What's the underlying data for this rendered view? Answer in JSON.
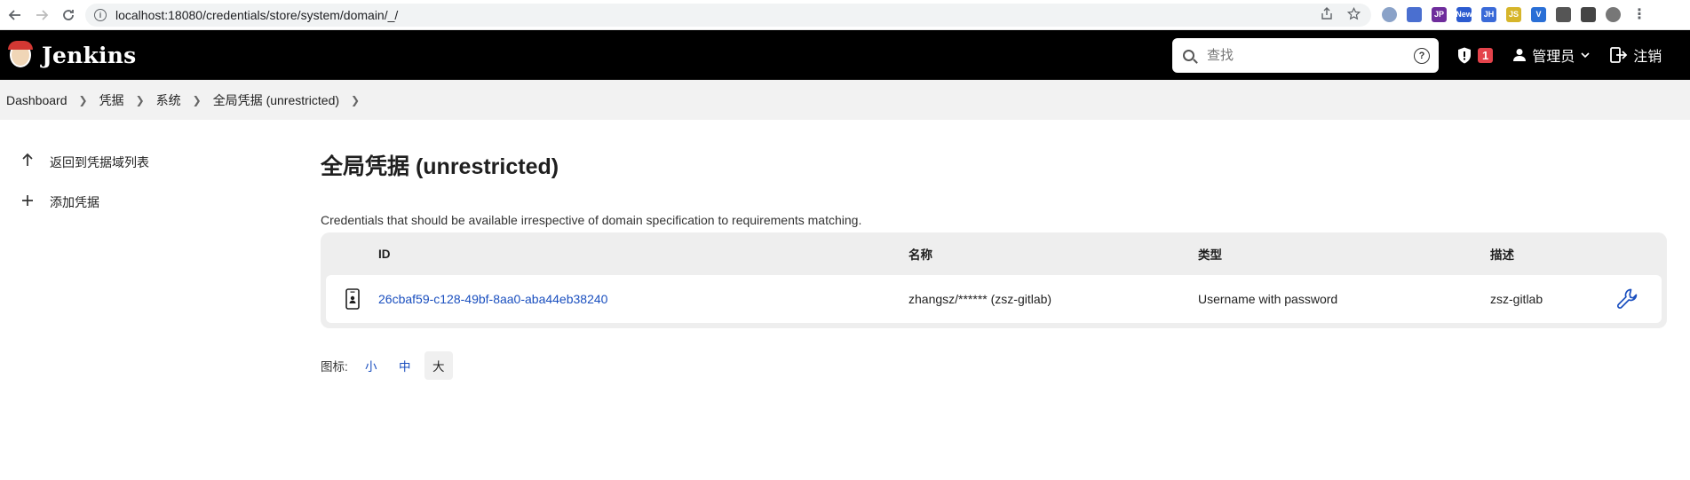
{
  "browser": {
    "url": "localhost:18080/credentials/store/system/domain/_/",
    "extensions": [
      {
        "name": "circle-ext-icon",
        "color": "#8aa2c8",
        "label": ""
      },
      {
        "name": "compass-ext-icon",
        "color": "#4a6fd0",
        "label": ""
      },
      {
        "name": "jp-ext-icon",
        "color": "#6e2c9c",
        "label": "JP"
      },
      {
        "name": "new-ext-icon",
        "color": "#2c5bd0",
        "label": "New"
      },
      {
        "name": "jh-ext-icon",
        "color": "#3a6ad8",
        "label": "JH"
      },
      {
        "name": "js-ext-icon",
        "color": "#d6b52a",
        "label": "JS"
      },
      {
        "name": "vue-ext-icon",
        "color": "#2a6fd6",
        "label": "V"
      },
      {
        "name": "puzzle-ext-icon",
        "color": "#555555",
        "label": ""
      },
      {
        "name": "sidepanel-ext-icon",
        "color": "#444444",
        "label": ""
      },
      {
        "name": "profile-avatar",
        "color": "#777777",
        "label": ""
      }
    ]
  },
  "header": {
    "title": "Jenkins",
    "search_placeholder": "查找",
    "security_count": "1",
    "user_label": "管理员",
    "logout_label": "注销"
  },
  "breadcrumb": [
    "Dashboard",
    "凭据",
    "系统",
    "全局凭据 (unrestricted)"
  ],
  "sidebar": {
    "items": [
      {
        "label": "返回到凭据域列表",
        "icon": "arrow-up-icon"
      },
      {
        "label": "添加凭据",
        "icon": "plus-icon"
      }
    ]
  },
  "main": {
    "title": "全局凭据 (unrestricted)",
    "description": "Credentials that should be available irrespective of domain specification to requirements matching.",
    "columns": [
      "ID",
      "名称",
      "类型",
      "描述"
    ],
    "rows": [
      {
        "id": "26cbaf59-c128-49bf-8aa0-aba44eb38240",
        "name": "zhangsz/****** (zsz-gitlab)",
        "type": "Username with password",
        "description": "zsz-gitlab"
      }
    ],
    "icon_size_label": "图标:",
    "icon_sizes": [
      "小",
      "中",
      "大"
    ],
    "icon_size_selected": "大"
  }
}
